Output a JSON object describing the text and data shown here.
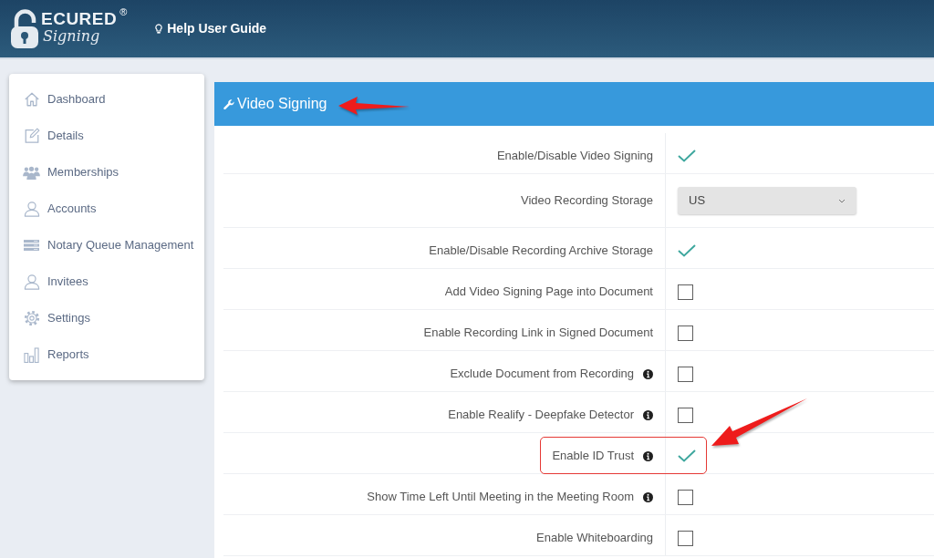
{
  "header": {
    "logo": {
      "letters": "ECURED",
      "script": "Signing",
      "mark": "®"
    },
    "help_link": "Help User Guide"
  },
  "sidebar": {
    "items": [
      {
        "label": "Dashboard"
      },
      {
        "label": "Details"
      },
      {
        "label": "Memberships"
      },
      {
        "label": "Accounts"
      },
      {
        "label": "Notary Queue Management"
      },
      {
        "label": "Invitees"
      },
      {
        "label": "Settings"
      },
      {
        "label": "Reports"
      }
    ]
  },
  "panel": {
    "title": "Video Signing",
    "title_callout": true,
    "rows": [
      {
        "kind": "checkbox",
        "label": "Enable/Disable Video Signing",
        "info": false,
        "checked": true,
        "highlighted": false
      },
      {
        "kind": "select",
        "label": "Video Recording Storage",
        "info": false,
        "value": "US",
        "highlighted": false
      },
      {
        "kind": "checkbox",
        "label": "Enable/Disable Recording Archive Storage",
        "info": false,
        "checked": true,
        "highlighted": false
      },
      {
        "kind": "checkbox",
        "label": "Add Video Signing Page into Document",
        "info": false,
        "checked": false,
        "highlighted": false
      },
      {
        "kind": "checkbox",
        "label": "Enable Recording Link in Signed Document",
        "info": false,
        "checked": false,
        "highlighted": false
      },
      {
        "kind": "checkbox",
        "label": "Exclude Document from Recording",
        "info": true,
        "checked": false,
        "highlighted": false
      },
      {
        "kind": "checkbox",
        "label": "Enable Realify - Deepfake Detector",
        "info": true,
        "checked": false,
        "highlighted": false
      },
      {
        "kind": "checkbox",
        "label": "Enable ID Trust",
        "info": true,
        "checked": true,
        "highlighted": true
      },
      {
        "kind": "checkbox",
        "label": "Show Time Left Until Meeting in the Meeting Room",
        "info": true,
        "checked": false,
        "highlighted": false
      },
      {
        "kind": "checkbox",
        "label": "Enable Whiteboarding",
        "info": false,
        "checked": false,
        "highlighted": false
      }
    ]
  }
}
